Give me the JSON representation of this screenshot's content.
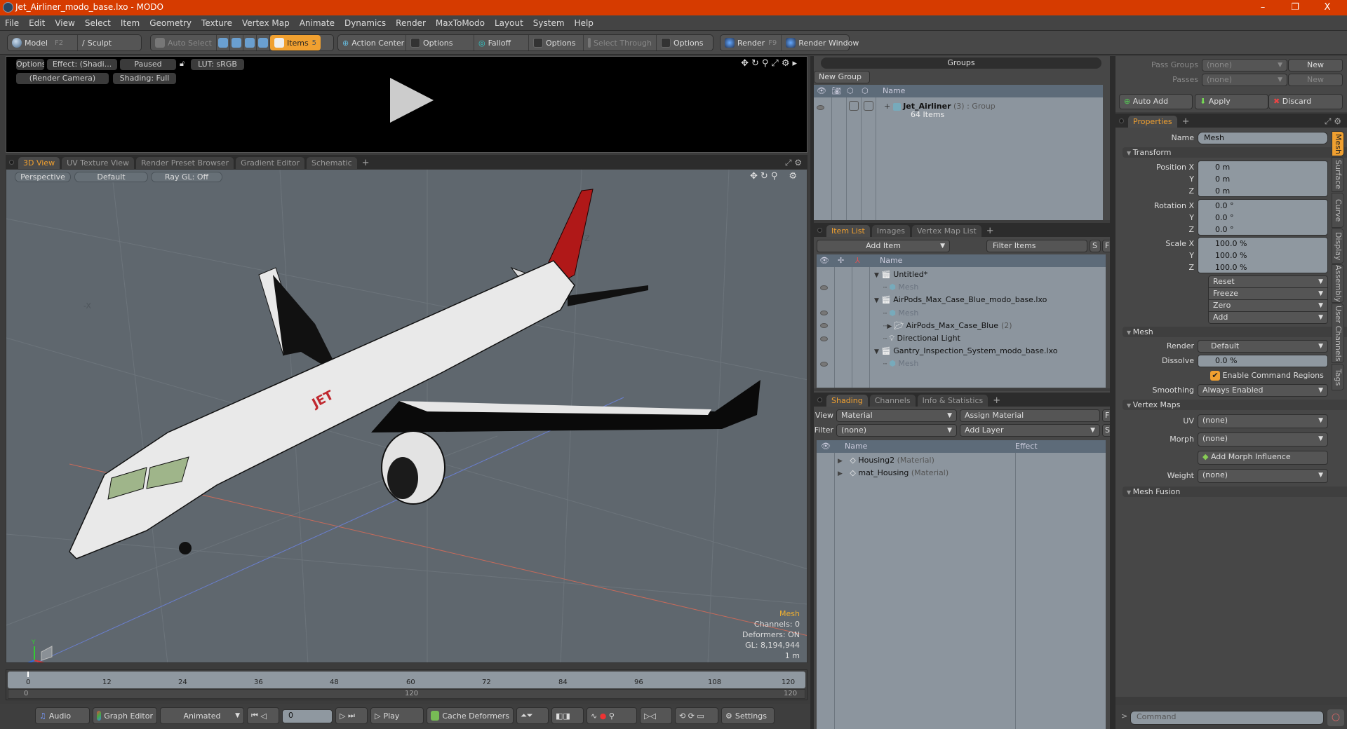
{
  "window": {
    "title": "Jet_Airliner_modo_base.lxo - MODO",
    "controls": [
      "–",
      "❐",
      "X"
    ]
  },
  "menu": [
    "File",
    "Edit",
    "View",
    "Select",
    "Item",
    "Geometry",
    "Texture",
    "Vertex Map",
    "Animate",
    "Dynamics",
    "Render",
    "MaxToModo",
    "Layout",
    "System",
    "Help"
  ],
  "toolbar": {
    "model": "Model",
    "model_key": "F2",
    "sculpt": "Sculpt",
    "auto_select": "Auto Select",
    "items": "Items",
    "items_key": "5",
    "action_center": "Action Center",
    "options1": "Options",
    "falloff": "Falloff",
    "options2": "Options",
    "select_through": "Select Through",
    "options3": "Options",
    "render": "Render",
    "render_key": "F9",
    "render_window": "Render Window"
  },
  "preview": {
    "options": "Options",
    "effect": "Effect: (Shadi...",
    "paused": "Paused",
    "lut": "LUT: sRGB",
    "camera": "(Render Camera)",
    "shading": "Shading: Full"
  },
  "viewport_tabs": [
    "3D View",
    "UV Texture View",
    "Render Preset Browser",
    "Gradient Editor",
    "Schematic"
  ],
  "viewport": {
    "projection": "Perspective",
    "style": "Default",
    "raygl": "Ray GL: Off",
    "axis_labels": {
      "neg_x": "-X",
      "neg_z": "-Z"
    },
    "hud": {
      "title": "Mesh",
      "channels": "Channels: 0",
      "deformers": "Deformers: ON",
      "gl": "GL: 8,194,944",
      "scale": "1 m"
    },
    "gizmo": {
      "x": "X",
      "y": "Y",
      "z": "Z"
    }
  },
  "timeline": {
    "ticks": [
      "0",
      "12",
      "24",
      "36",
      "48",
      "60",
      "72",
      "84",
      "96",
      "108",
      "120"
    ],
    "range_start": "0",
    "range_mid": "120",
    "range_end": "120"
  },
  "transport": {
    "audio": "Audio",
    "graph_editor": "Graph Editor",
    "mode": "Animated",
    "frame": "0",
    "play": "Play",
    "cache_deformers": "Cache Deformers",
    "settings": "Settings"
  },
  "groups": {
    "title": "Groups",
    "new_group": "New Group",
    "col_name": "Name",
    "items": [
      {
        "name": "Jet_Airliner",
        "count": "(3)",
        "type": ": Group",
        "sub": "64 Items"
      }
    ]
  },
  "item_list": {
    "tabs": [
      "Item List",
      "Images",
      "Vertex Map List"
    ],
    "add_item": "Add Item",
    "filter_placeholder": "Filter Items",
    "s": "S",
    "f": "F",
    "col_name": "Name",
    "rows": [
      {
        "label": "Untitled*",
        "kind": "scene",
        "level": 0,
        "eye": false
      },
      {
        "label": "Mesh",
        "kind": "mesh",
        "level": 1,
        "eye": true,
        "dim": true
      },
      {
        "label": "AirPods_Max_Case_Blue_modo_base.lxo",
        "kind": "scene",
        "level": 0,
        "eye": false
      },
      {
        "label": "Mesh",
        "kind": "mesh",
        "level": 1,
        "eye": true,
        "dim": true
      },
      {
        "label": "AirPods_Max_Case_Blue",
        "suffix": "(2)",
        "kind": "folder",
        "level": 1,
        "eye": true
      },
      {
        "label": "Directional Light",
        "kind": "light",
        "level": 1,
        "eye": true
      },
      {
        "label": "Gantry_Inspection_System_modo_base.lxo",
        "kind": "scene",
        "level": 0,
        "eye": false
      },
      {
        "label": "Mesh",
        "kind": "mesh",
        "level": 1,
        "eye": true,
        "dim": true
      }
    ]
  },
  "shading": {
    "tabs": [
      "Shading",
      "Channels",
      "Info & Statistics"
    ],
    "view_label": "View",
    "view_value": "Material",
    "assign_material": "Assign Material",
    "f": "F",
    "filter_label": "Filter",
    "filter_value": "(none)",
    "add_layer": "Add Layer",
    "s": "S",
    "col_name": "Name",
    "col_effect": "Effect",
    "rows": [
      {
        "name": "Housing2",
        "type": "(Material)"
      },
      {
        "name": "mat_Housing",
        "type": "(Material)"
      }
    ]
  },
  "passes": {
    "pass_groups_label": "Pass Groups",
    "pass_groups_value": "(none)",
    "new1": "New",
    "passes_label": "Passes",
    "passes_value": "(none)",
    "new2": "New",
    "auto_add": "Auto Add",
    "apply": "Apply",
    "discard": "Discard"
  },
  "properties": {
    "tab": "Properties",
    "name_label": "Name",
    "name_value": "Mesh",
    "transform": "Transform",
    "position": {
      "label": "Position X",
      "x": "0 m",
      "y": "0 m",
      "z": "0 m"
    },
    "rotation": {
      "label": "Rotation X",
      "x": "0.0 °",
      "y": "0.0 °",
      "z": "0.0 °"
    },
    "scale": {
      "label": "Scale X",
      "x": "100.0 %",
      "y": "100.0 %",
      "z": "100.0 %"
    },
    "axis_y": "Y",
    "axis_z": "Z",
    "actions": [
      "Reset",
      "Freeze",
      "Zero",
      "Add"
    ],
    "mesh_section": "Mesh",
    "render_label": "Render",
    "render_value": "Default",
    "dissolve_label": "Dissolve",
    "dissolve_value": "0.0 %",
    "enable_command_regions": "Enable Command Regions",
    "enable_command_regions_checked": true,
    "smoothing_label": "Smoothing",
    "smoothing_value": "Always Enabled",
    "vertex_maps": "Vertex Maps",
    "uv_label": "UV",
    "uv_value": "(none)",
    "morph_label": "Morph",
    "morph_value": "(none)",
    "add_morph": "Add Morph Influence",
    "weight_label": "Weight",
    "weight_value": "(none)",
    "mesh_fusion": "Mesh Fusion",
    "side_tabs": [
      "Mesh",
      "Surface",
      "Curve",
      "Display",
      "Assembly",
      "User Channels",
      "Tags"
    ]
  },
  "command": {
    "prompt": ">",
    "placeholder": "Command"
  },
  "colors": {
    "accent": "#f0a030",
    "titlebar": "#d63b00",
    "viewport_bg": "#5f676e"
  }
}
